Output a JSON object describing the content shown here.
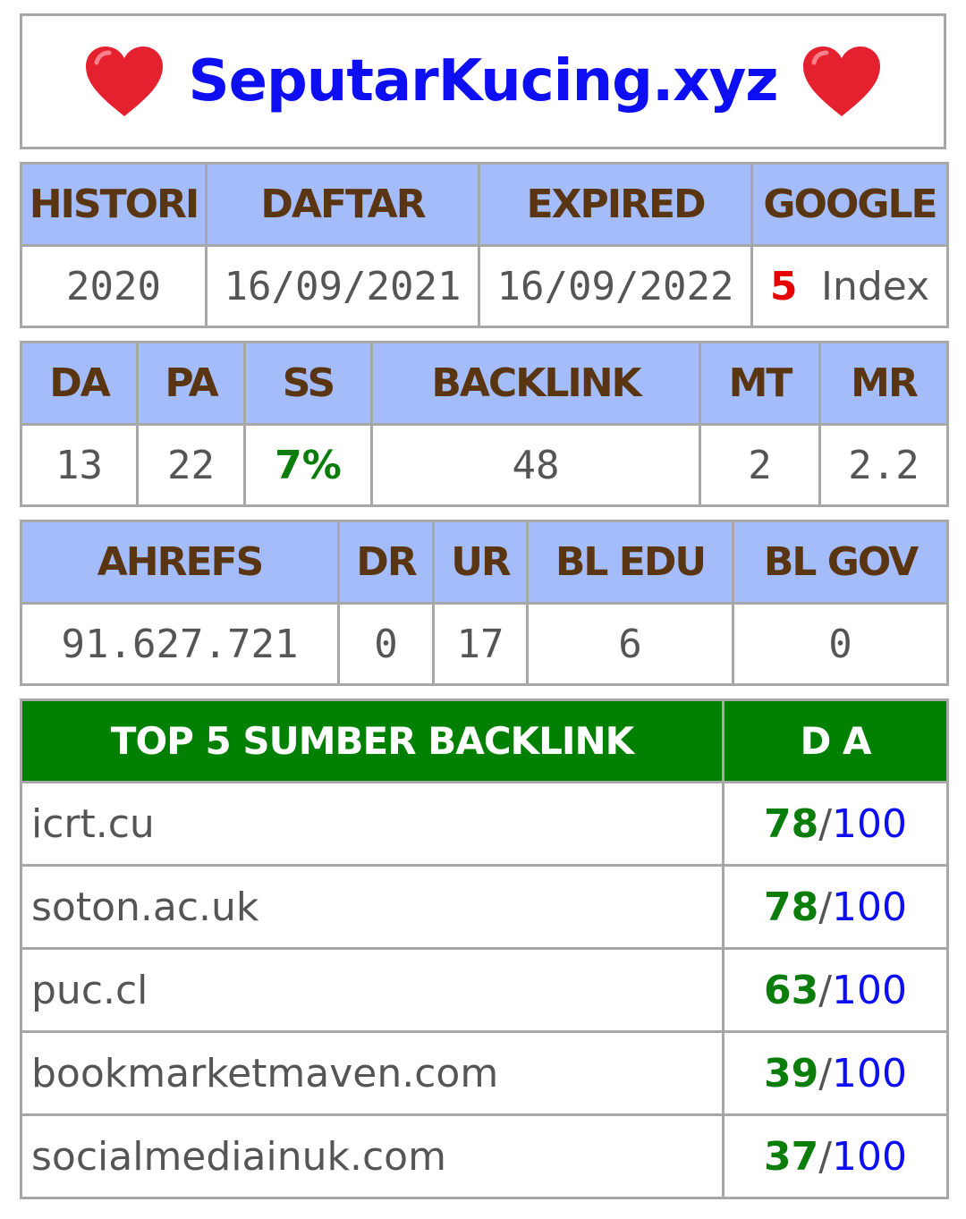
{
  "site": {
    "name": "SeputarKucing.xyz",
    "icon": "red-heart-icon"
  },
  "domain_info": {
    "headers": [
      "HISTORI",
      "DAFTAR",
      "EXPIRED",
      "GOOGLE"
    ],
    "histori": "2020",
    "daftar": "16/09/2021",
    "expired": "16/09/2022",
    "google_count": "5",
    "google_suffix": "Index"
  },
  "metrics": {
    "headers": [
      "DA",
      "PA",
      "SS",
      "BACKLINK",
      "MT",
      "MR"
    ],
    "da": "13",
    "pa": "22",
    "ss": "7%",
    "backlink": "48",
    "mt": "2",
    "mr": "2.2"
  },
  "ahrefs": {
    "headers": [
      "AHREFS",
      "DR",
      "UR",
      "BL EDU",
      "BL GOV"
    ],
    "ahrefs": "91.627.721",
    "dr": "0",
    "ur": "17",
    "bl_edu": "6",
    "bl_gov": "0"
  },
  "top_sources": {
    "header_source": "TOP 5 SUMBER BACKLINK",
    "header_da": "D A",
    "separator": "/",
    "max": "100",
    "rows": [
      {
        "site": "icrt.cu",
        "da": "78"
      },
      {
        "site": "soton.ac.uk",
        "da": "78"
      },
      {
        "site": "puc.cl",
        "da": "63"
      },
      {
        "site": "bookmarketmaven.com",
        "da": "39"
      },
      {
        "site": "socialmediainuk.com",
        "da": "37"
      }
    ]
  },
  "colors": {
    "title_blue": "#0d0ff2",
    "header_bg": "#a4bcf9",
    "header_text": "#5a3512",
    "green": "#0a7d0a",
    "green_head_bg": "#008000",
    "red": "#e60000",
    "border": "#a7a7a7"
  }
}
